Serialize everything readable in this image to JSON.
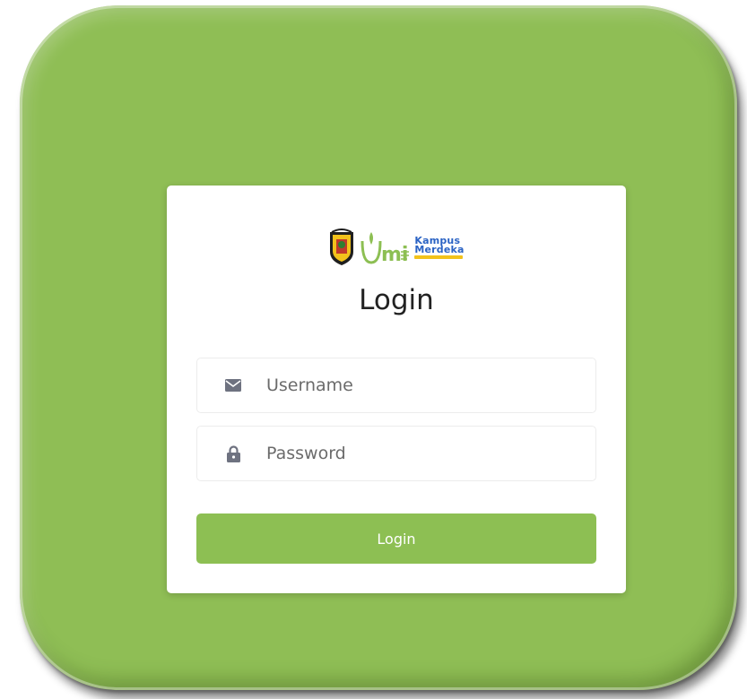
{
  "logo": {
    "umi_wordmark": "Umi",
    "kampus_line1": "Kampus",
    "kampus_line2": "Merdeka"
  },
  "form": {
    "title": "Login",
    "username": {
      "placeholder": "Username",
      "value": "",
      "icon": "envelope-icon"
    },
    "password": {
      "placeholder": "Password",
      "value": "",
      "icon": "lock-icon"
    },
    "submit_label": "Login"
  },
  "colors": {
    "frame_green": "#8fbe55",
    "button_green": "#8dbf53",
    "card_background": "#ffffff",
    "icon_gray": "#6e7280",
    "kampus_blue": "#2b63c4",
    "kampus_yellow": "#f2c21b"
  }
}
